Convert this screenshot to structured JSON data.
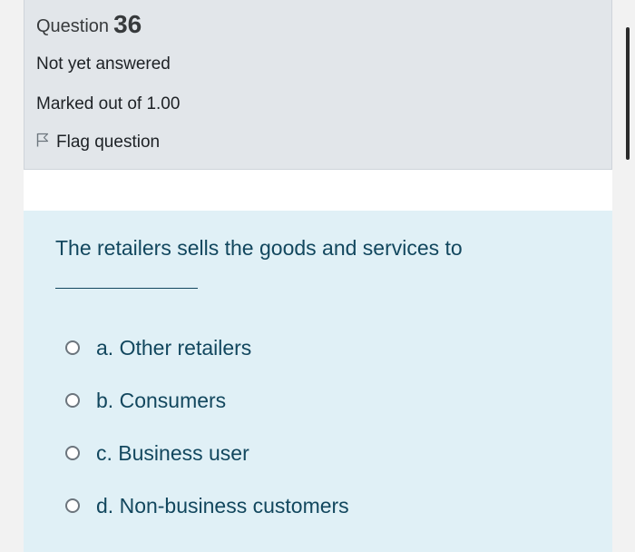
{
  "question": {
    "label": "Question",
    "number": "36",
    "state": "Not yet answered",
    "grade": "Marked out of 1.00",
    "flag_label": "Flag question"
  },
  "content": {
    "text": "The retailers sells the goods and services to",
    "options": [
      {
        "letter": "a.",
        "text": "Other retailers"
      },
      {
        "letter": "b.",
        "text": "Consumers"
      },
      {
        "letter": "c.",
        "text": "Business user"
      },
      {
        "letter": "d.",
        "text": "Non-business customers"
      }
    ]
  },
  "colors": {
    "info_bg": "#e2e6ea",
    "content_bg": "#e0f0f6",
    "text_accent": "#12475e"
  }
}
